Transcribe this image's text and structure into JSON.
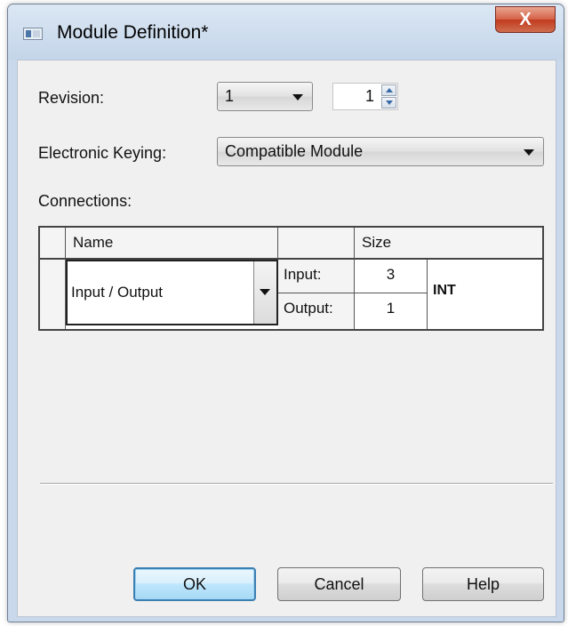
{
  "window": {
    "title": "Module Definition*",
    "close_glyph": "X"
  },
  "revision": {
    "label": "Revision:",
    "major_value": "1",
    "minor_value": "1"
  },
  "electronic_keying": {
    "label": "Electronic Keying:",
    "value": "Compatible Module"
  },
  "connections": {
    "label": "Connections:",
    "headers": {
      "name": "Name",
      "size": "Size"
    },
    "row": {
      "name": "Input / Output",
      "input_label": "Input:",
      "input_size": "3",
      "output_label": "Output:",
      "output_size": "1",
      "data_type": "INT"
    }
  },
  "buttons": {
    "ok": "OK",
    "cancel": "Cancel",
    "help": "Help"
  },
  "colors": {
    "titlebar": "#c4d5e9",
    "close_button": "#c13b20",
    "client": "#f0f0f0",
    "default_button_border": "#3c7fb1"
  }
}
